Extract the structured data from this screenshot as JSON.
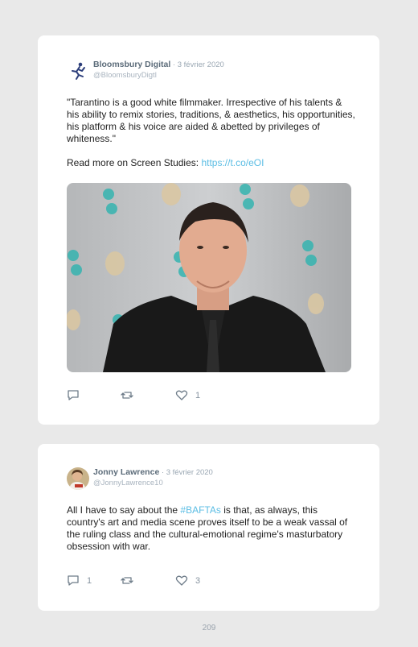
{
  "tweets": [
    {
      "author_name": "Bloomsbury Digital",
      "separator": " · ",
      "date": "3 février 2020",
      "handle": "@BloomsburyDigtl",
      "text_paragraphs": [
        "\"Tarantino is a good white filmmaker. Irrespective of his talents & his ability to remix stories, traditions, & aesthetics, his opportunities, his platform & his voice are aided & abetted by privileges of whiteness.\""
      ],
      "read_more_prefix": "Read more on Screen Studies: ",
      "read_more_link": "https://t.co/eOI",
      "avatar_icon": "bloomsbury-logo-icon",
      "reply_count": "",
      "retweet_count": "",
      "like_count": "1"
    },
    {
      "author_name": "Jonny Lawrence",
      "separator": " · ",
      "date": "3 février 2020",
      "handle": "@JonnyLawrence10",
      "text_before_hashtag": "All I have to say about the ",
      "hashtag": "#BAFTAs",
      "text_after_hashtag": " is that, as always, this country's art and media scene proves itself to be a weak vassal of the ruling class and the cultural-emotional regime's masturbatory obsession with war.",
      "avatar_icon": "user-photo-avatar",
      "reply_count": "1",
      "retweet_count": "",
      "like_count": "3"
    }
  ],
  "page_number": "209",
  "colors": {
    "background": "#e9e9e9",
    "card": "#ffffff",
    "link": "#5bbde4",
    "author": "#5b6b79",
    "muted": "#9aa7b3"
  },
  "icons": [
    "reply-icon",
    "retweet-icon",
    "like-icon"
  ]
}
